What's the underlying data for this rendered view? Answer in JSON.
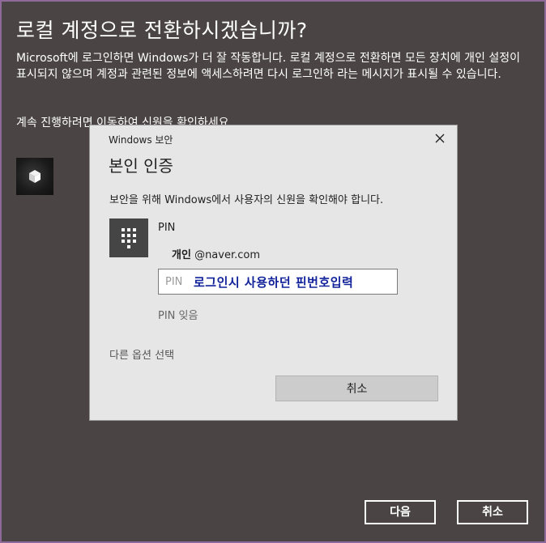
{
  "background": {
    "title": "로컬 계정으로 전환하시겠습니까?",
    "body": "Microsoft에 로그인하면 Windows가 더 잘 작동합니다. 로컬 계정으로 전환하면 모든 장치에 개인 설정이 표시되지 않으며 계정과 관련된 정보에 액세스하려면 다시 로그인하 라는 메시지가 표시될 수 있습니다.",
    "continue_text": "계속 진행하려면 이동하여 신원을 확인하세요",
    "avatar_icon": "user-avatar-icon",
    "next_label": "다음",
    "cancel_label": "취소"
  },
  "dialog": {
    "app_name": "Windows 보안",
    "close_icon": "close-icon",
    "title": "본인 인증",
    "description": "보안을 위해 Windows에서 사용자의 신원을 확인해야 합니다.",
    "pin_icon": "keypad-icon",
    "pin_label": "PIN",
    "account_name": "개인",
    "account_email": "@naver.com",
    "pin_placeholder": "PIN",
    "pin_annotation": "로그인시 사용하던 핀번호입력",
    "forgot_pin": "PIN 잊음",
    "other_options": "다른 옵션 선택",
    "cancel_label": "취소"
  },
  "colors": {
    "background": "#4a4544",
    "frame_border": "#8e6a9a",
    "dialog": "#e6e6e6",
    "annotation": "#11229a"
  }
}
